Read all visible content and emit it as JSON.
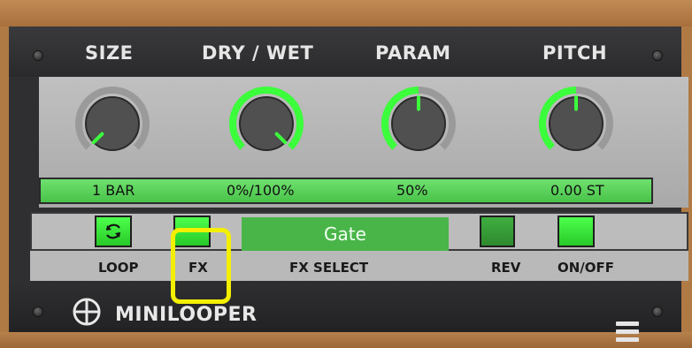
{
  "plugin": {
    "name": "MINILOOPER",
    "top_labels": [
      "SIZE",
      "DRY / WET",
      "PARAM",
      "PITCH"
    ],
    "knobs": [
      {
        "name": "size-knob",
        "value": "1 BAR",
        "level": 0.0
      },
      {
        "name": "dry-wet-knob",
        "value": "0%/100%",
        "level": 1.0
      },
      {
        "name": "param-knob",
        "value": "50%",
        "level": 0.5
      },
      {
        "name": "pitch-knob",
        "value": "0.00 ST",
        "level": 0.5
      }
    ],
    "fx_select_value": "Gate",
    "bottom_labels": {
      "loop": "LOOP",
      "fx": "FX",
      "fx_select": "FX SELECT",
      "rev": "REV",
      "onoff": "ON/OFF"
    },
    "colors": {
      "accent_green": "#3cff3c",
      "highlight_yellow": "#f3ef00"
    }
  }
}
